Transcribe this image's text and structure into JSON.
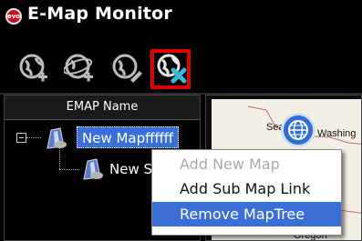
{
  "window": {
    "title": "E-Map Monitor",
    "app_icon_text": "evo"
  },
  "toolbar": {
    "buttons": [
      {
        "icon": "add-map-icon",
        "active": false
      },
      {
        "icon": "add-sub-map-icon",
        "active": false
      },
      {
        "icon": "edit-map-icon",
        "active": false
      },
      {
        "icon": "remove-map-icon",
        "active": true
      }
    ]
  },
  "tree": {
    "column_header": "EMAP Name",
    "nodes": [
      {
        "label": "New Mapffffff",
        "selected": true,
        "expanded": true
      },
      {
        "label": "New S",
        "selected": false
      }
    ]
  },
  "map": {
    "labels": {
      "seattle": "Seat",
      "washington": "Washing",
      "oregon": "Oregon"
    }
  },
  "context_menu": {
    "items": [
      {
        "label": "Add New Map",
        "enabled": false,
        "highlighted": false
      },
      {
        "label": "Add Sub Map Link",
        "enabled": true,
        "highlighted": false
      },
      {
        "label": "Remove MapTree",
        "enabled": true,
        "highlighted": true
      }
    ]
  },
  "colors": {
    "selection": "#3b6fd8",
    "active_outline": "#e00000",
    "background": "#000000"
  }
}
